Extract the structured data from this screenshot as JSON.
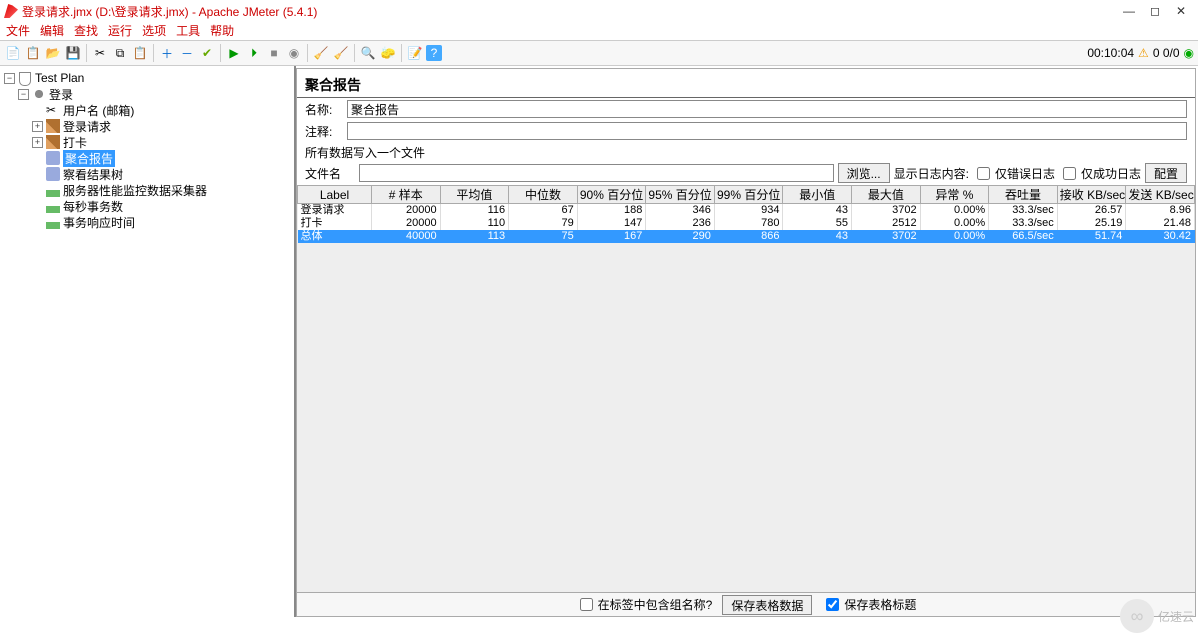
{
  "window": {
    "title": "登录请求.jmx (D:\\登录请求.jmx) - Apache JMeter (5.4.1)",
    "timer": "00:10:04",
    "thread_status": "0 0/0"
  },
  "menu": [
    "文件",
    "编辑",
    "查找",
    "运行",
    "选项",
    "工具",
    "帮助"
  ],
  "tree": {
    "root": "Test Plan",
    "n1": "登录",
    "n2": "用户名 (邮箱)",
    "n3": "登录请求",
    "n4": "打卡",
    "n5": "聚合报告",
    "n6": "察看结果树",
    "n7": "服务器性能监控数据采集器",
    "n8": "每秒事务数",
    "n9": "事务响应时间"
  },
  "panel": {
    "title": "聚合报告",
    "name_label": "名称:",
    "name_value": "聚合报告",
    "comment_label": "注释:",
    "comment_value": "",
    "write_all_label": "所有数据写入一个文件",
    "file_label": "文件名",
    "file_value": "",
    "browse": "浏览...",
    "show_log_label": "显示日志内容:",
    "only_error": "仅错误日志",
    "only_success": "仅成功日志",
    "configure": "配置"
  },
  "table": {
    "headers": [
      "Label",
      "# 样本",
      "平均值",
      "中位数",
      "90% 百分位",
      "95% 百分位",
      "99% 百分位",
      "最小值",
      "最大值",
      "异常 %",
      "吞吐量",
      "接收 KB/sec",
      "发送 KB/sec"
    ],
    "rows": [
      {
        "label": "登录请求",
        "samples": "20000",
        "avg": "116",
        "median": "67",
        "p90": "188",
        "p95": "346",
        "p99": "934",
        "min": "43",
        "max": "3702",
        "err": "0.00%",
        "thr": "33.3/sec",
        "recv": "26.57",
        "sent": "8.96"
      },
      {
        "label": "打卡",
        "samples": "20000",
        "avg": "110",
        "median": "79",
        "p90": "147",
        "p95": "236",
        "p99": "780",
        "min": "55",
        "max": "2512",
        "err": "0.00%",
        "thr": "33.3/sec",
        "recv": "25.19",
        "sent": "21.48"
      },
      {
        "label": "总体",
        "samples": "40000",
        "avg": "113",
        "median": "75",
        "p90": "167",
        "p95": "290",
        "p99": "866",
        "min": "43",
        "max": "3702",
        "err": "0.00%",
        "thr": "66.5/sec",
        "recv": "51.74",
        "sent": "30.42",
        "total": true
      }
    ]
  },
  "bottom": {
    "include_group": "在标签中包含组名称?",
    "save_data": "保存表格数据",
    "save_header": "保存表格标题"
  },
  "watermark": "亿速云"
}
